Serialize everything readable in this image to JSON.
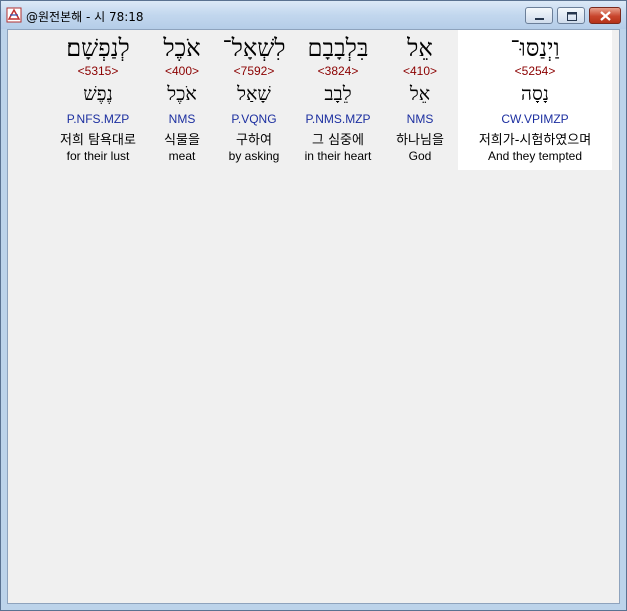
{
  "window": {
    "title": "@원전본해 - 시 78:18",
    "app_icon": "bible-app-icon",
    "controls": {
      "minimize_icon": "minimize-icon",
      "maximize_icon": "maximize-icon",
      "close_icon": "close-icon"
    }
  },
  "colors": {
    "strong_number": "#8b0000",
    "parsing": "#1c2fa0",
    "selected_background": "#ffffff",
    "close_button": "#c8452d"
  },
  "words": [
    {
      "hebrew": "וַיְנַסּוּ־",
      "strong": "<5254>",
      "lemma": "נָסָה",
      "parse": "CW.VPIMZP",
      "korean": "저희가-시험하였으며",
      "english": "And they tempted",
      "selected": true
    },
    {
      "hebrew": "אֵל",
      "strong": "<410>",
      "lemma": "אֵל",
      "parse": "NMS",
      "korean": "하나님을",
      "english": "God",
      "selected": false
    },
    {
      "hebrew": "בִּלְבָבָם",
      "strong": "<3824>",
      "lemma": "לֵבָב",
      "parse": "P.NMS.MZP",
      "korean": "그 심중에",
      "english": "in their heart",
      "selected": false
    },
    {
      "hebrew": "לִשְׁאָל־",
      "strong": "<7592>",
      "lemma": "שָׁאַל",
      "parse": "P.VQNG",
      "korean": "구하여",
      "english": "by asking",
      "selected": false
    },
    {
      "hebrew": "אֹכֶל",
      "strong": "<400>",
      "lemma": "אֹכֶל",
      "parse": "NMS",
      "korean": "식물을",
      "english": "meat",
      "selected": false
    },
    {
      "hebrew": "לְנַפְשָׁם׃",
      "strong": "<5315>",
      "lemma": "נֶפֶשׁ",
      "parse": "P.NFS.MZP",
      "korean": "저희 탐욕대로",
      "english": "for their lust",
      "selected": false
    }
  ]
}
